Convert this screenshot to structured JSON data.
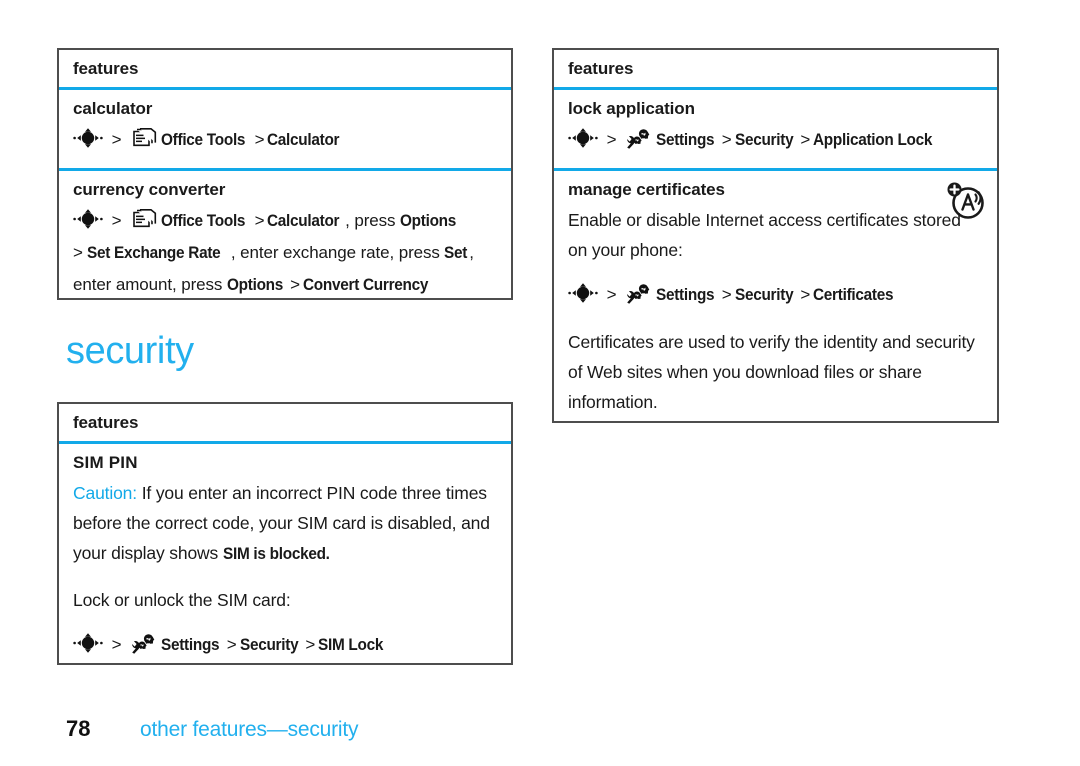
{
  "page": {
    "number": "78",
    "footer_text": "other features—security",
    "section_heading": "security",
    "accent_color": "#12a9e8",
    "heading_color": "#22b0ee",
    "border_color": "#4d4d4d"
  },
  "left_column": {
    "box_calculator": {
      "header": "features",
      "rows": [
        {
          "title": "calculator",
          "lines": [
            {
              "nav_icon": "navigation-key-icon",
              "chevron": ">",
              "menu_icon": "office-tools-icon",
              "segments": [
                {
                  "text": "Office Tools",
                  "style": "menu"
                },
                {
                  "text": ">",
                  "style": "sep"
                },
                {
                  "text": "Calculator",
                  "style": "menu"
                }
              ]
            }
          ]
        },
        {
          "title": "currency converter",
          "lines": [
            {
              "nav_icon": "navigation-key-icon",
              "chevron": ">",
              "menu_icon": "office-tools-icon",
              "segments": [
                {
                  "text": "Office Tools",
                  "style": "menu"
                },
                {
                  "text": ">",
                  "style": "sep"
                },
                {
                  "text": "Calculator",
                  "style": "menu"
                },
                {
                  "text": ", press ",
                  "style": "plain"
                },
                {
                  "text": "Options",
                  "style": "menu"
                }
              ]
            },
            {
              "segments": [
                {
                  "text": "> ",
                  "style": "plain"
                },
                {
                  "text": "Set Exchange Rate",
                  "style": "menu"
                },
                {
                  "text": ", enter exchange rate, press ",
                  "style": "plain"
                },
                {
                  "text": "Set",
                  "style": "menu"
                },
                {
                  "text": ",",
                  "style": "plain"
                }
              ]
            },
            {
              "segments": [
                {
                  "text": "enter amount, press ",
                  "style": "plain"
                },
                {
                  "text": "Options",
                  "style": "menu"
                },
                {
                  "text": ">",
                  "style": "sep"
                },
                {
                  "text": "Convert Currency",
                  "style": "menu"
                }
              ]
            }
          ]
        }
      ]
    },
    "box_sim_pin": {
      "header": "features",
      "rows": [
        {
          "title": "SIM PIN",
          "paragraphs": [
            {
              "caution_label": "Caution:",
              "segments": [
                {
                  "text": " If you enter an incorrect PIN code three times before the correct code, your SIM card is disabled, and your display shows ",
                  "style": "plain"
                },
                {
                  "text": "SIM is blocked.",
                  "style": "menu"
                }
              ]
            },
            {
              "segments": [
                {
                  "text": "Lock or unlock the SIM card:",
                  "style": "plain"
                }
              ]
            }
          ],
          "lines": [
            {
              "nav_icon": "navigation-key-icon",
              "chevron": ">",
              "menu_icon": "settings-icon",
              "segments": [
                {
                  "text": "Settings",
                  "style": "menu"
                },
                {
                  "text": ">",
                  "style": "sep"
                },
                {
                  "text": "Security",
                  "style": "menu"
                },
                {
                  "text": ">",
                  "style": "sep"
                },
                {
                  "text": "SIM Lock",
                  "style": "menu"
                }
              ]
            }
          ]
        }
      ]
    }
  },
  "right_column": {
    "box_lock_application": {
      "header": "features",
      "marker_icon": "certificate-antenna-icon",
      "rows": [
        {
          "title": "lock application",
          "lines": [
            {
              "nav_icon": "navigation-key-icon",
              "chevron": ">",
              "menu_icon": "settings-icon",
              "segments": [
                {
                  "text": "Settings",
                  "style": "menu"
                },
                {
                  "text": ">",
                  "style": "sep"
                },
                {
                  "text": "Security",
                  "style": "menu"
                },
                {
                  "text": ">",
                  "style": "sep"
                },
                {
                  "text": "Application Lock",
                  "style": "menu"
                }
              ]
            }
          ]
        },
        {
          "title": "manage certificates",
          "paragraph_before": "Enable or disable Internet access certificates stored on your phone:",
          "lines": [
            {
              "nav_icon": "navigation-key-icon",
              "chevron": ">",
              "menu_icon": "settings-icon",
              "segments": [
                {
                  "text": "Settings",
                  "style": "menu"
                },
                {
                  "text": ">",
                  "style": "sep"
                },
                {
                  "text": "Security",
                  "style": "menu"
                },
                {
                  "text": ">",
                  "style": "sep"
                },
                {
                  "text": "Certificates",
                  "style": "menu"
                }
              ]
            }
          ],
          "paragraph_after": "Certificates are used to verify the identity and security of Web sites when you download files or share information."
        }
      ]
    }
  }
}
